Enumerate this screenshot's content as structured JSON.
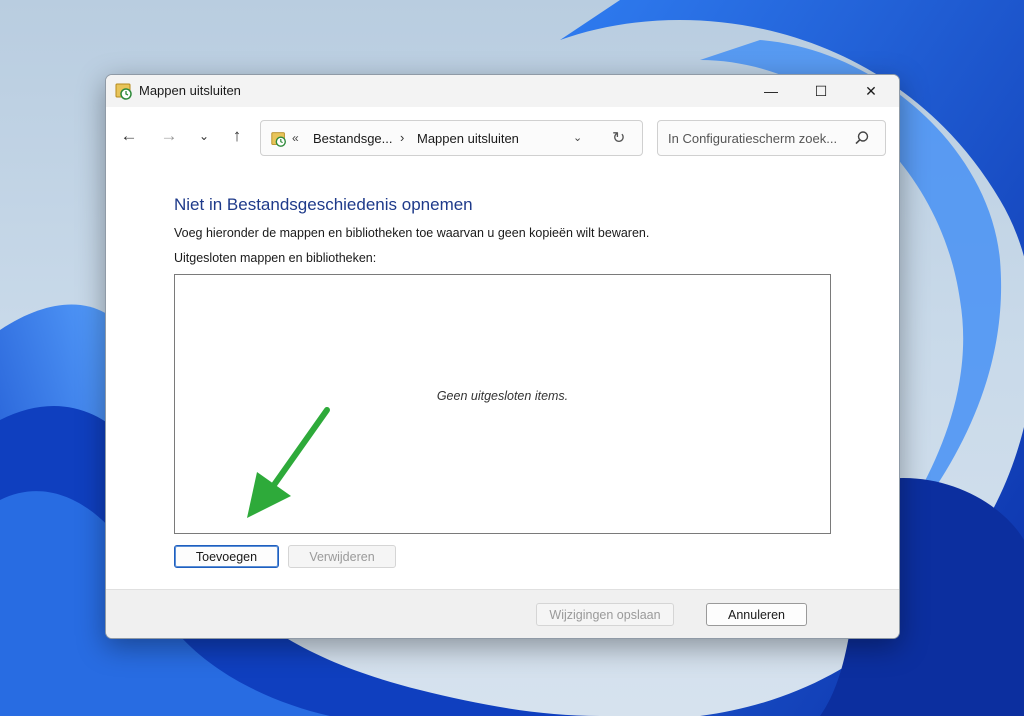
{
  "window": {
    "title": "Mappen uitsluiten"
  },
  "titlebar": {
    "minimize_glyph": "—",
    "maximize_glyph": "☐",
    "close_glyph": "✕"
  },
  "nav": {
    "back_glyph": "←",
    "forward_glyph": "→",
    "recent_glyph": "⌄",
    "up_glyph": "↑"
  },
  "address": {
    "overflow_glyph": "«",
    "crumb1": "Bestandsge...",
    "separator": "›",
    "crumb2": "Mappen uitsluiten",
    "dropdown_glyph": "⌄",
    "refresh_glyph": "↻"
  },
  "search": {
    "placeholder": "In Configuratiescherm zoek..."
  },
  "main": {
    "title": "Niet in Bestandsgeschiedenis opnemen",
    "instruction": "Voeg hieronder de mappen en bibliotheken toe waarvan u geen kopieën wilt bewaren.",
    "list_label": "Uitgesloten mappen en bibliotheken:",
    "empty_text": "Geen uitgesloten items.",
    "add_button": "Toevoegen",
    "remove_button": "Verwijderen"
  },
  "footer": {
    "save_button": "Wijzigingen opslaan",
    "cancel_button": "Annuleren"
  },
  "icons": {
    "window_icon": "control-panel-history-icon",
    "search_icon": "magnifier-icon",
    "annotation": "green-arrow"
  },
  "colors": {
    "title_blue": "#1e3a8a",
    "annotation_green": "#2eaa3a",
    "focus_blue": "#1f5fbf"
  }
}
